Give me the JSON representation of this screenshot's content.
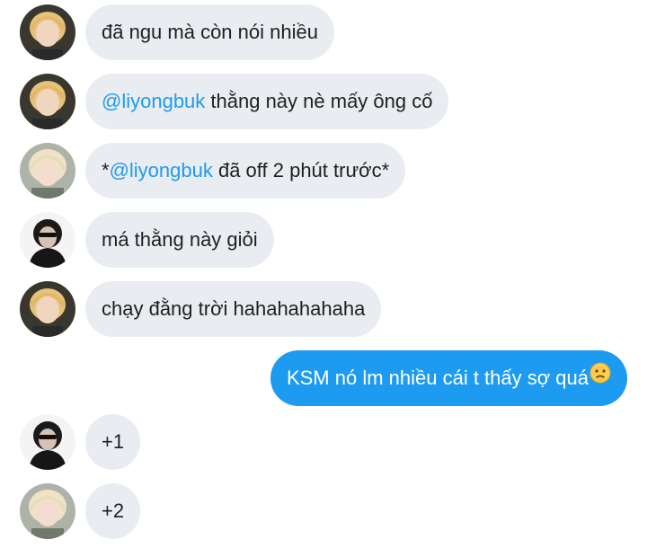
{
  "colors": {
    "incoming_bubble": "#e9edf1",
    "outgoing_bubble": "#1d9bf0",
    "mention": "#1d9bf0"
  },
  "messages": [
    {
      "direction": "incoming",
      "avatar": "blond-avatar",
      "text": "đã ngu mà còn nói nhiều"
    },
    {
      "direction": "incoming",
      "avatar": "blond-avatar",
      "mention": "@liyongbuk",
      "text": " thằng này nè mấy ông cố"
    },
    {
      "direction": "incoming",
      "avatar": "light-hair-avatar",
      "prefix": "*",
      "mention": "@liyongbuk",
      "text": " đã off 2 phút trước*"
    },
    {
      "direction": "incoming",
      "avatar": "dark-hair-avatar",
      "text": "má thằng này giỏi"
    },
    {
      "direction": "incoming",
      "avatar": "blond-avatar",
      "text": "chạy đằng trời hahahahahaha"
    },
    {
      "direction": "outgoing",
      "text": "KSM nó lm nhiều cái t thấy sợ quá",
      "emoji": "slightly-frowning-face-emoji"
    },
    {
      "direction": "incoming",
      "avatar": "dark-hair-avatar",
      "text": "+1"
    },
    {
      "direction": "incoming",
      "avatar": "light-hair-avatar",
      "text": "+2"
    }
  ]
}
